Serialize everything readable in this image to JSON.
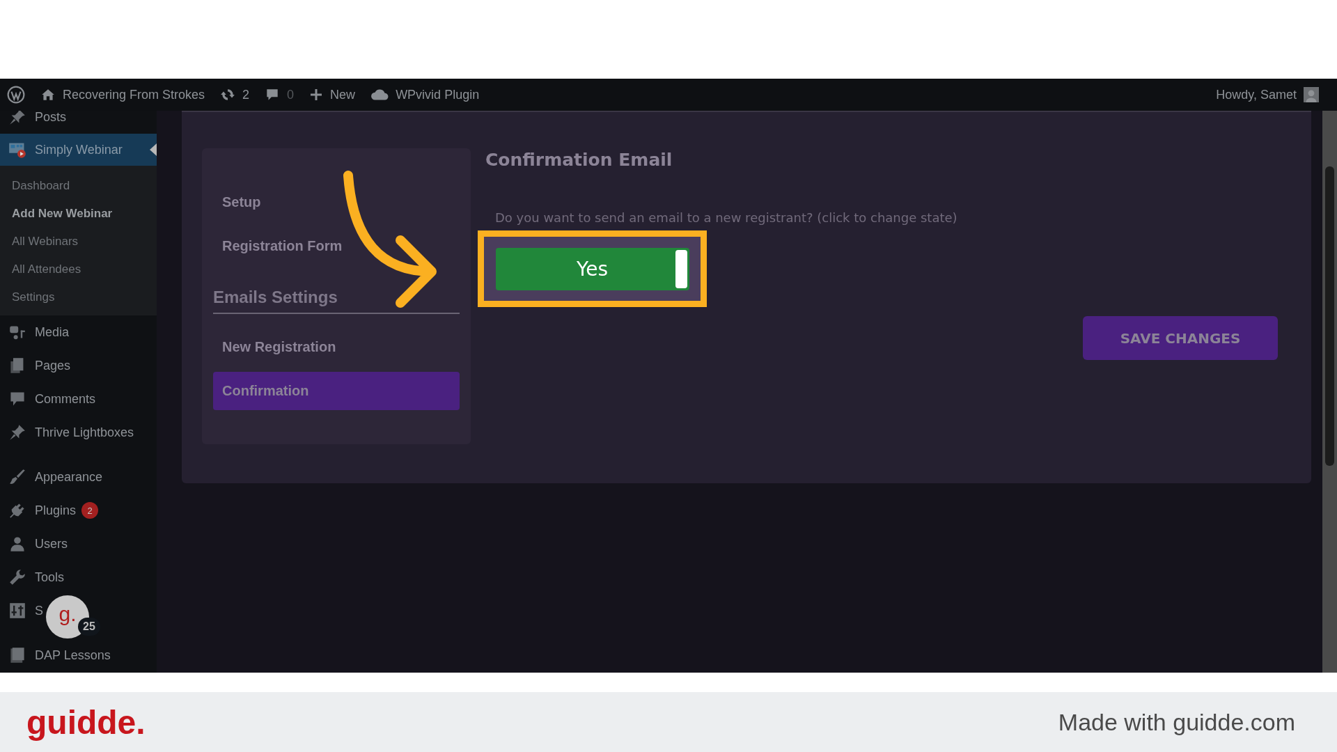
{
  "admin_bar": {
    "site_name": "Recovering From Strokes",
    "updates": "2",
    "comments": "0",
    "new": "New",
    "plugin": "WPvivid Plugin",
    "greeting": "Howdy, Samet"
  },
  "sidebar": {
    "groups": [
      [
        {
          "label": "Posts",
          "selected": false
        },
        {
          "label": "Simply Webinar",
          "selected": true,
          "children": [
            {
              "label": "Dashboard",
              "selected": false
            },
            {
              "label": "Add New Webinar",
              "selected": true
            },
            {
              "label": "All Webinars",
              "selected": false
            },
            {
              "label": "All Attendees",
              "selected": false
            },
            {
              "label": "Settings",
              "selected": false
            }
          ]
        },
        {
          "label": "Media",
          "selected": false
        },
        {
          "label": "Pages",
          "selected": false
        },
        {
          "label": "Comments",
          "selected": false
        },
        {
          "label": "Thrive Lightboxes",
          "selected": false
        }
      ],
      [
        {
          "label": "Appearance",
          "selected": false
        },
        {
          "label": "Plugins",
          "selected": false,
          "badge": "2"
        },
        {
          "label": "Users",
          "selected": false
        },
        {
          "label": "Tools",
          "selected": false
        },
        {
          "label": "S",
          "selected": false
        }
      ],
      [
        {
          "label": "DAP Lessons",
          "selected": false
        }
      ]
    ]
  },
  "nav": {
    "items": [
      {
        "kind": "link",
        "label": "Setup",
        "selected": false
      },
      {
        "kind": "link",
        "label": "Registration Form",
        "selected": false
      },
      {
        "kind": "heading",
        "label": "Emails Settings"
      },
      {
        "kind": "link",
        "label": "New Registration",
        "selected": false
      },
      {
        "kind": "link",
        "label": "Confirmation",
        "selected": true
      }
    ]
  },
  "content": {
    "title": "Confirmation Email",
    "question": "Do you want to send an email to a new registrant? (click to change state)",
    "toggle": {
      "label": "Yes",
      "on": true
    },
    "save_button": "SAVE CHANGES"
  },
  "recorder": {
    "logo": "g.",
    "count": "25"
  },
  "footer": {
    "logo": "guidde.",
    "credit": "Made with guidde.com"
  }
}
